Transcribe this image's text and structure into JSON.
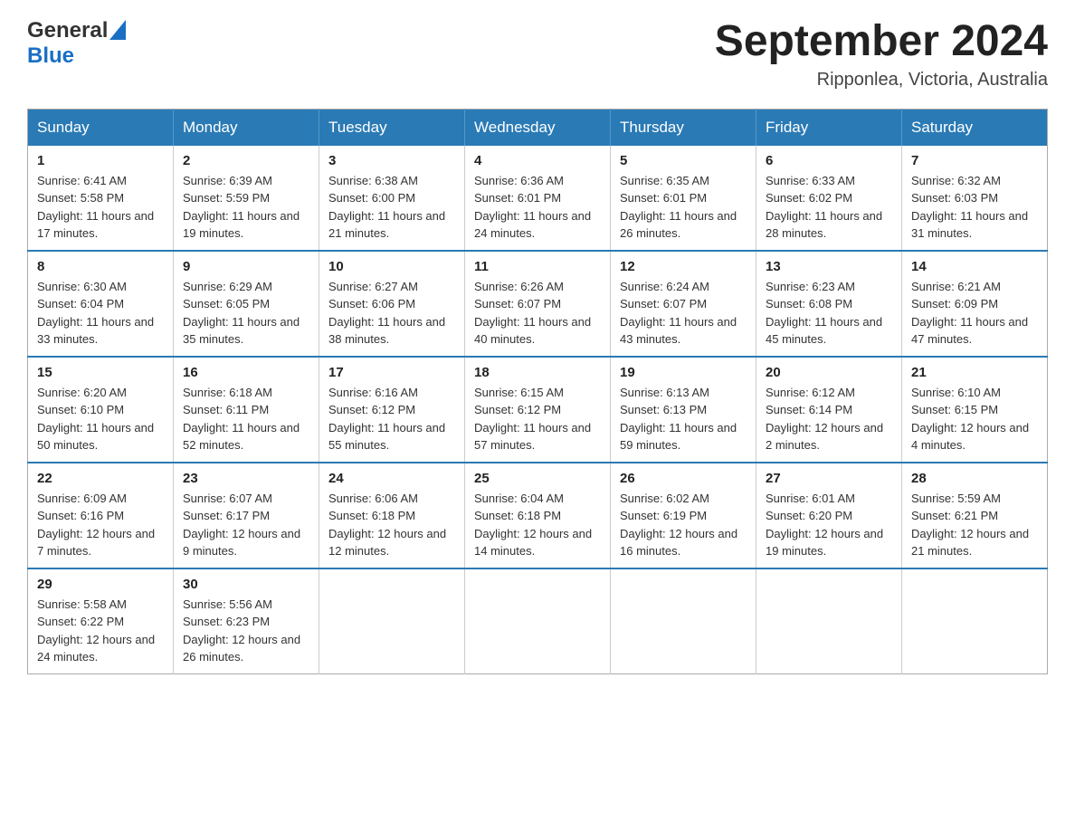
{
  "header": {
    "logo_general": "General",
    "logo_blue": "Blue",
    "month_title": "September 2024",
    "location": "Ripponlea, Victoria, Australia"
  },
  "days_of_week": [
    "Sunday",
    "Monday",
    "Tuesday",
    "Wednesday",
    "Thursday",
    "Friday",
    "Saturday"
  ],
  "weeks": [
    [
      {
        "day": "1",
        "sunrise": "6:41 AM",
        "sunset": "5:58 PM",
        "daylight": "11 hours and 17 minutes."
      },
      {
        "day": "2",
        "sunrise": "6:39 AM",
        "sunset": "5:59 PM",
        "daylight": "11 hours and 19 minutes."
      },
      {
        "day": "3",
        "sunrise": "6:38 AM",
        "sunset": "6:00 PM",
        "daylight": "11 hours and 21 minutes."
      },
      {
        "day": "4",
        "sunrise": "6:36 AM",
        "sunset": "6:01 PM",
        "daylight": "11 hours and 24 minutes."
      },
      {
        "day": "5",
        "sunrise": "6:35 AM",
        "sunset": "6:01 PM",
        "daylight": "11 hours and 26 minutes."
      },
      {
        "day": "6",
        "sunrise": "6:33 AM",
        "sunset": "6:02 PM",
        "daylight": "11 hours and 28 minutes."
      },
      {
        "day": "7",
        "sunrise": "6:32 AM",
        "sunset": "6:03 PM",
        "daylight": "11 hours and 31 minutes."
      }
    ],
    [
      {
        "day": "8",
        "sunrise": "6:30 AM",
        "sunset": "6:04 PM",
        "daylight": "11 hours and 33 minutes."
      },
      {
        "day": "9",
        "sunrise": "6:29 AM",
        "sunset": "6:05 PM",
        "daylight": "11 hours and 35 minutes."
      },
      {
        "day": "10",
        "sunrise": "6:27 AM",
        "sunset": "6:06 PM",
        "daylight": "11 hours and 38 minutes."
      },
      {
        "day": "11",
        "sunrise": "6:26 AM",
        "sunset": "6:07 PM",
        "daylight": "11 hours and 40 minutes."
      },
      {
        "day": "12",
        "sunrise": "6:24 AM",
        "sunset": "6:07 PM",
        "daylight": "11 hours and 43 minutes."
      },
      {
        "day": "13",
        "sunrise": "6:23 AM",
        "sunset": "6:08 PM",
        "daylight": "11 hours and 45 minutes."
      },
      {
        "day": "14",
        "sunrise": "6:21 AM",
        "sunset": "6:09 PM",
        "daylight": "11 hours and 47 minutes."
      }
    ],
    [
      {
        "day": "15",
        "sunrise": "6:20 AM",
        "sunset": "6:10 PM",
        "daylight": "11 hours and 50 minutes."
      },
      {
        "day": "16",
        "sunrise": "6:18 AM",
        "sunset": "6:11 PM",
        "daylight": "11 hours and 52 minutes."
      },
      {
        "day": "17",
        "sunrise": "6:16 AM",
        "sunset": "6:12 PM",
        "daylight": "11 hours and 55 minutes."
      },
      {
        "day": "18",
        "sunrise": "6:15 AM",
        "sunset": "6:12 PM",
        "daylight": "11 hours and 57 minutes."
      },
      {
        "day": "19",
        "sunrise": "6:13 AM",
        "sunset": "6:13 PM",
        "daylight": "11 hours and 59 minutes."
      },
      {
        "day": "20",
        "sunrise": "6:12 AM",
        "sunset": "6:14 PM",
        "daylight": "12 hours and 2 minutes."
      },
      {
        "day": "21",
        "sunrise": "6:10 AM",
        "sunset": "6:15 PM",
        "daylight": "12 hours and 4 minutes."
      }
    ],
    [
      {
        "day": "22",
        "sunrise": "6:09 AM",
        "sunset": "6:16 PM",
        "daylight": "12 hours and 7 minutes."
      },
      {
        "day": "23",
        "sunrise": "6:07 AM",
        "sunset": "6:17 PM",
        "daylight": "12 hours and 9 minutes."
      },
      {
        "day": "24",
        "sunrise": "6:06 AM",
        "sunset": "6:18 PM",
        "daylight": "12 hours and 12 minutes."
      },
      {
        "day": "25",
        "sunrise": "6:04 AM",
        "sunset": "6:18 PM",
        "daylight": "12 hours and 14 minutes."
      },
      {
        "day": "26",
        "sunrise": "6:02 AM",
        "sunset": "6:19 PM",
        "daylight": "12 hours and 16 minutes."
      },
      {
        "day": "27",
        "sunrise": "6:01 AM",
        "sunset": "6:20 PM",
        "daylight": "12 hours and 19 minutes."
      },
      {
        "day": "28",
        "sunrise": "5:59 AM",
        "sunset": "6:21 PM",
        "daylight": "12 hours and 21 minutes."
      }
    ],
    [
      {
        "day": "29",
        "sunrise": "5:58 AM",
        "sunset": "6:22 PM",
        "daylight": "12 hours and 24 minutes."
      },
      {
        "day": "30",
        "sunrise": "5:56 AM",
        "sunset": "6:23 PM",
        "daylight": "12 hours and 26 minutes."
      },
      null,
      null,
      null,
      null,
      null
    ]
  ],
  "labels": {
    "sunrise": "Sunrise:",
    "sunset": "Sunset:",
    "daylight": "Daylight:"
  }
}
